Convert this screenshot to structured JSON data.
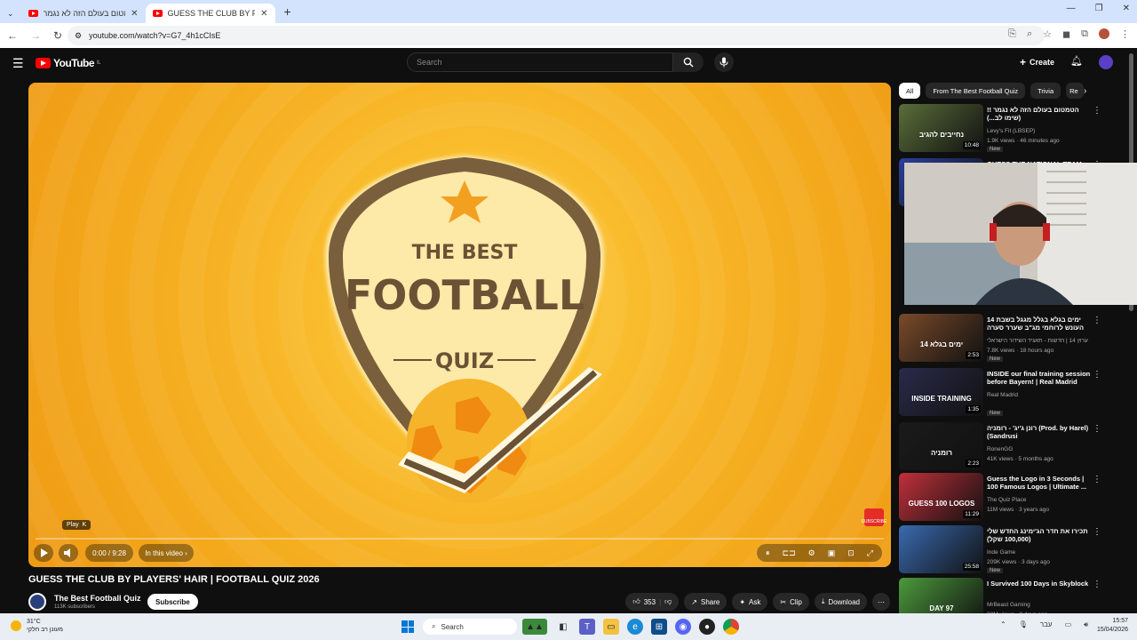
{
  "browser": {
    "tabs": [
      {
        "title": "הטמטום בעולם הזה לא נגמר !!"
      },
      {
        "title": "GUESS THE CLUB BY PLAYERS' H"
      }
    ],
    "url": "youtube.com/watch?v=G7_4h1cCIsE"
  },
  "header": {
    "logo_text": "YouTube",
    "logo_country": "IL",
    "search_placeholder": "Search",
    "create_label": "Create"
  },
  "player": {
    "badge_line1": "THE BEST",
    "badge_line2": "FOOTBALL",
    "badge_line3": "QUIZ",
    "play_tooltip": "Play",
    "play_tooltip_key": "K",
    "time": "0:00 / 9:28",
    "chapters_label": "In this video",
    "subscribe_icon_text": "SUBSCRIBE",
    "progress_fraction": 0.0
  },
  "video": {
    "title": "GUESS THE CLUB BY PLAYERS' HAIR | FOOTBALL QUIZ 2026",
    "channel_name": "The Best Football Quiz",
    "channel_subs": "113K subscribers",
    "subscribe_label": "Subscribe",
    "like_count": "353",
    "share_label": "Share",
    "ask_label": "Ask",
    "clip_label": "Clip",
    "download_label": "Download"
  },
  "chips": [
    "All",
    "From The Best Football Quiz",
    "Trivia",
    "Re"
  ],
  "recommendations": [
    {
      "title": "הטמטום בעולם הזה לא נגמר !! (שימו לב...)",
      "channel": "Levy's Fit (LBSEP)",
      "meta": "1.9K views · 46 minutes ago",
      "duration": "10:48",
      "badge": "New",
      "thumb_text": "נחייבים להגיב",
      "color": "#5a6e3a"
    },
    {
      "title": "GUESS THE NATIONAL TEAM",
      "channel": "",
      "meta": "",
      "duration": "",
      "badge": "New",
      "thumb_text": "",
      "color": "#2a3f9a"
    },
    {
      "title": "14 ימים בגלא בגלל מגגל בשבת העונש לרוחמי מג\"ב שערר סערה",
      "channel": "ערוץ 14 | חדשות - תאגיד השידור הישראלי",
      "meta": "7.8K views · 18 hours ago",
      "duration": "2:53",
      "badge": "New",
      "thumb_text": "14 ימים בגלא",
      "color": "#7a4a2a"
    },
    {
      "title": "INSIDE our final training session before Bayern! | Real Madrid",
      "channel": "Real Madrid",
      "meta": "",
      "duration": "1:35",
      "badge": "New",
      "thumb_text": "INSIDE TRAINING",
      "color": "#2a2a4a"
    },
    {
      "title": "רונן ג'יג' - רומניה (Prod. by Harel) (Sandrusi",
      "channel": "RonenGG",
      "meta": "41K views · 5 months ago",
      "duration": "2:23",
      "badge": "",
      "thumb_text": "רומניה",
      "color": "#1a1a1a"
    },
    {
      "title": "Guess the Logo in 3 Seconds | 100 Famous Logos | Ultimate ...",
      "channel": "The Quiz Place",
      "meta": "11M views · 3 years ago",
      "duration": "11:29",
      "badge": "",
      "thumb_text": "GUESS 100 LOGOS",
      "color": "#c0303a"
    },
    {
      "title": "תכירו את חדר הג'ימינג החדש שלי (100,000 שקל)",
      "channel": "Inde Game",
      "meta": "209K views · 3 days ago",
      "duration": "25:58",
      "badge": "New",
      "thumb_text": "",
      "color": "#3a6ab0"
    },
    {
      "title": "I Survived 100 Days in Skyblock",
      "channel": "MrBeast Gaming",
      "meta": "32M views · 3 days ago",
      "duration": "",
      "badge": "New",
      "thumb_text": "DAY 97",
      "color": "#4c9a3c"
    }
  ],
  "taskbar": {
    "weather_temp": "31°C",
    "weather_desc": "מעונן רב חלקי",
    "search_label": "Search",
    "lang": "עבר",
    "time": "15:57",
    "date": "15/04/2026"
  }
}
